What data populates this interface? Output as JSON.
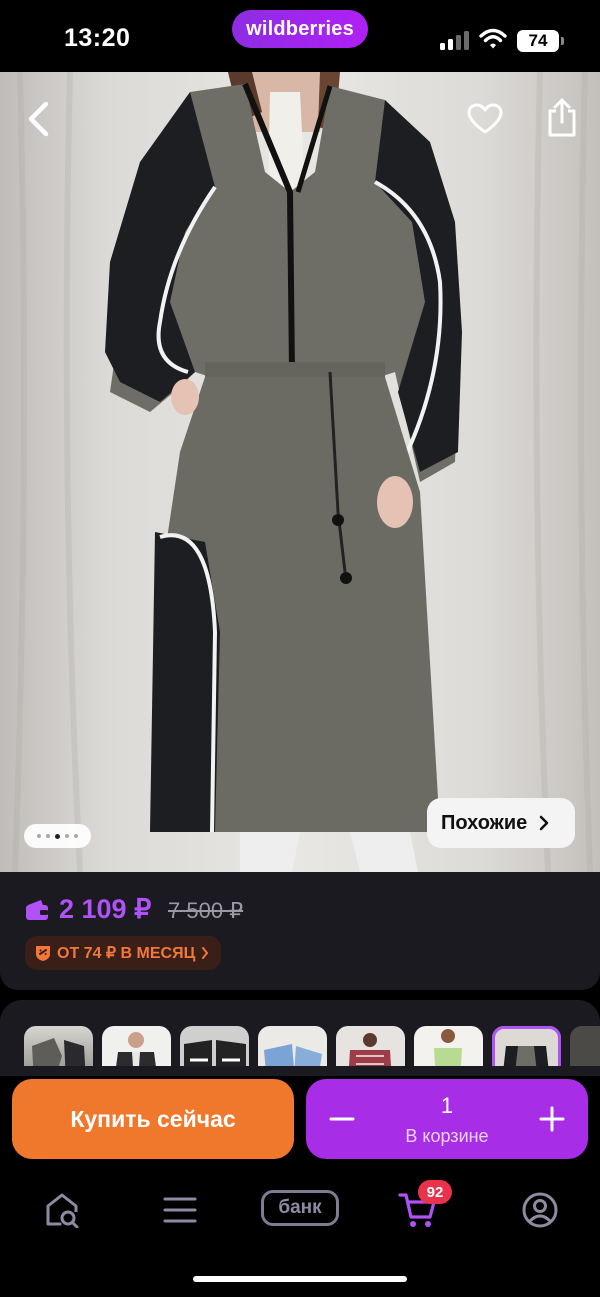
{
  "status_bar": {
    "time": "13:20",
    "brand": "wildberries",
    "battery": "74"
  },
  "gallery": {
    "similar_label": "Похожие",
    "page_count": 5,
    "active_page": 3
  },
  "price": {
    "current": "2 109 ₽",
    "old": "7 500 ₽",
    "installment": "ОТ 74 ₽ В МЕСЯЦ"
  },
  "thumbnails": [
    {
      "name": "look-1"
    },
    {
      "name": "look-2"
    },
    {
      "name": "look-3"
    },
    {
      "name": "look-4"
    },
    {
      "name": "look-5"
    },
    {
      "name": "look-6"
    },
    {
      "name": "look-7",
      "selected": true
    },
    {
      "name": "look-8"
    }
  ],
  "actions": {
    "buy_now": "Купить сейчас",
    "quantity": "1",
    "in_cart_label": "В корзине"
  },
  "tabbar": {
    "bank_label": "банк",
    "cart_badge": "92"
  },
  "colors": {
    "brand_purple": "#a82de6",
    "buy_orange": "#f0782c",
    "price_purple": "#b052f7",
    "badge_red": "#e9324b"
  }
}
